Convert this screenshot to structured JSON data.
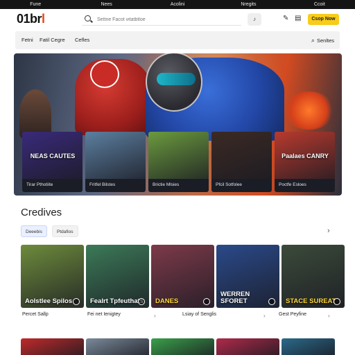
{
  "topbar": [
    "Fune",
    "Nees",
    "Acolini",
    "Nregits",
    "Ccoit"
  ],
  "header": {
    "logo_main": "01br",
    "logo_accent": "l",
    "search_placeholder": "Settne Facot vitatbtloe",
    "cta": "Csop Now"
  },
  "icons": {
    "search": "search-icon",
    "mic": "mic-icon",
    "chat": "chat-icon",
    "grid": "grid-icon",
    "mic_glyph": "♪",
    "chat_glyph": "✎",
    "grid_glyph": "▤"
  },
  "subnav": {
    "items": [
      "Fetni",
      "Fatil Cegre",
      "Cefles"
    ],
    "right": "Senltes"
  },
  "hero": {
    "cards": [
      {
        "title": "NEAS CAUTES",
        "caption": "Tirar Pthotiite",
        "color": "#3a2a7a"
      },
      {
        "title": "",
        "caption": "Fritfel Bilstes",
        "color": "#5c7fa0"
      },
      {
        "title": "",
        "caption": "Brictie Mlsies",
        "color": "#6b9a3e"
      },
      {
        "title": "",
        "caption": "Pfcil Sotfolee",
        "color": "#3b2a24"
      },
      {
        "title": "Paalaes CANRY",
        "caption": "Poctfe Esloes",
        "color": "#b83a2e"
      }
    ]
  },
  "section": {
    "title": "Credives",
    "chips": [
      "Deeebis",
      "Ptdafios"
    ],
    "arrow": "›"
  },
  "games": [
    {
      "title": "Aolstlee Spilos",
      "label": "Percet Sallp",
      "sub": "",
      "color": "#6d8b3c",
      "yellow": false
    },
    {
      "title": "Fealrt Tpfeuthats",
      "label": "Fei net Ienigtey",
      "sub": "",
      "color": "#3c7a58",
      "yellow": false
    },
    {
      "title": "DANES",
      "label": "Lsiay of Senglis",
      "sub": "",
      "color": "#7d3a4a",
      "yellow": true
    },
    {
      "title": "WERREN SFORET",
      "label": "",
      "sub": "",
      "color": "#2a4a8a",
      "yellow": false
    },
    {
      "title": "STACE SUREAT",
      "label": "Gest Peyfine",
      "sub": "",
      "color": "#3b4a3a",
      "yellow": true
    }
  ],
  "more_glyph": "›",
  "bottom_row": [
    "#c02a2a",
    "#7a8a9a",
    "#3aa04a",
    "#b02a4a",
    "#2a6a8a"
  ]
}
